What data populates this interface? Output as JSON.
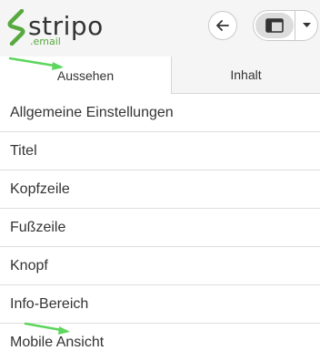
{
  "brand": {
    "name": "stripo",
    "sub": ".email",
    "accent": "#58a93f"
  },
  "toolbar": {
    "back_icon": "arrow-left-icon",
    "layout_icon": "layout-panel-icon",
    "dropdown_icon": "caret-down-icon"
  },
  "tabs": [
    {
      "label": "Aussehen",
      "active": true
    },
    {
      "label": "Inhalt",
      "active": false
    }
  ],
  "menu": {
    "items": [
      {
        "label": "Allgemeine Einstellungen"
      },
      {
        "label": "Titel"
      },
      {
        "label": "Kopfzeile"
      },
      {
        "label": "Fußzeile"
      },
      {
        "label": "Knopf"
      },
      {
        "label": "Info-Bereich"
      },
      {
        "label": "Mobile Ansicht"
      }
    ]
  },
  "annotations": {
    "arrow_color": "#5cd65c"
  }
}
